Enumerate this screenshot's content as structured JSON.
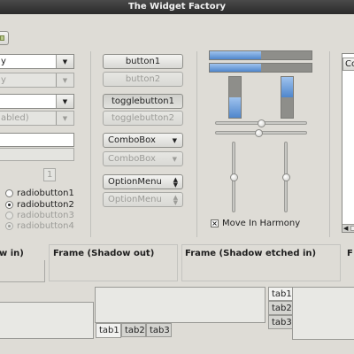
{
  "window": {
    "title": "The Widget Factory"
  },
  "toolbar_button_label": "",
  "col1": {
    "combo_active_text": "y",
    "combo_disabled_text": "y",
    "entry_combo_text": "",
    "entry_combo_disabled_text": "abled)",
    "spin_value": "1",
    "radios": [
      {
        "label": "radiobutton1",
        "checked": false,
        "disabled": false
      },
      {
        "label": "radiobutton2",
        "checked": true,
        "disabled": false
      },
      {
        "label": "radiobutton3",
        "checked": false,
        "disabled": true
      },
      {
        "label": "radiobutton4",
        "checked": true,
        "disabled": true
      }
    ]
  },
  "col2": {
    "button1": "button1",
    "button2": "button2",
    "togglebutton1": "togglebutton1",
    "togglebutton2": "togglebutton2",
    "combobox1": "ComboBox",
    "combobox2": "ComboBox",
    "optionmenu1": "OptionMenu",
    "optionmenu2": "OptionMenu"
  },
  "col3": {
    "hbar1_fraction": 0.5,
    "hbar2_fraction": 0.5,
    "vbar1_fraction": 0.5,
    "vbar2_fraction": 0.5,
    "hslider1_value": 0.5,
    "hslider2_value": 0.5,
    "vslider1_value": 0.5,
    "vslider2_value": 0.5,
    "move_in_harmony_label": "Move In Harmony",
    "move_in_harmony_checked": true
  },
  "col4": {
    "tree_header": "Co"
  },
  "frames": {
    "f1": "w in)",
    "f2": "Frame (Shadow out)",
    "f3": "Frame (Shadow etched in)",
    "f4": "F"
  },
  "notebook_bottom": {
    "tabs": [
      "tab1",
      "tab2",
      "tab3"
    ]
  },
  "notebook_left": {
    "tabs": [
      "tab1",
      "tab2",
      "tab3"
    ]
  }
}
